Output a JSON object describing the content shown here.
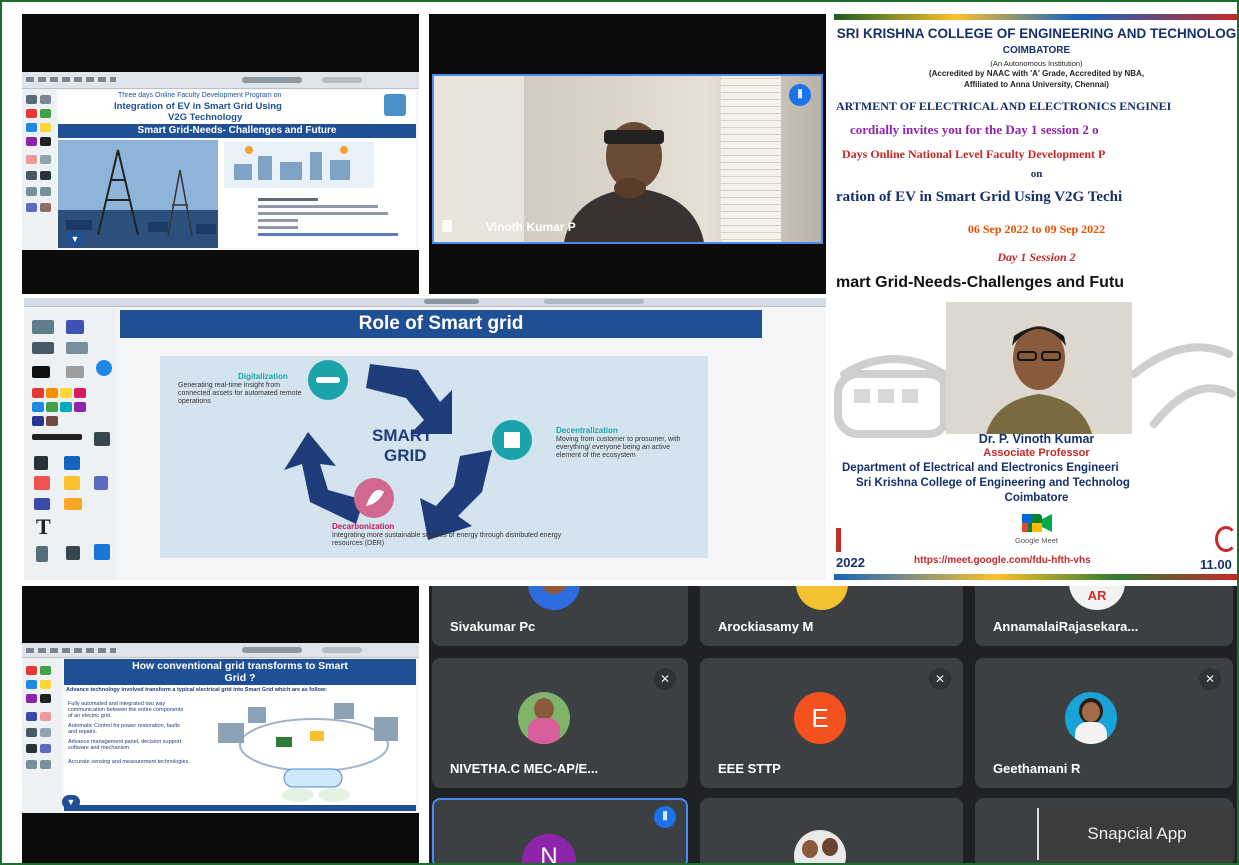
{
  "slide1": {
    "header": "Three days Online Faculty Development Program on",
    "title_line1": "Integration of EV in Smart Grid Using",
    "title_line2": "V2G Technology",
    "subtitle": "Smart Grid-Needs- Challenges and Future"
  },
  "speaker_tile": {
    "name": "Vinoth Kumar P"
  },
  "slide2": {
    "title": "Role of Smart grid",
    "center_line1": "SMART",
    "center_line2": "GRID",
    "digitalization_title": "Digitalization",
    "digitalization_text": "Generating real-time insight from connected assets for automated remote operations",
    "decentralization_title": "Decentralization",
    "decentralization_text": "Moving from customer to prosumer, with everything/ everyone being an active element of the ecosystem",
    "decarbonization_title": "Decarbonization",
    "decarbonization_text": "Integrating more sustainable sources of energy through distributed energy resources (DER)"
  },
  "slide3": {
    "title_line1": "How conventional grid transforms to Smart",
    "title_line2": "Grid ?",
    "lead": "Advance technology involved transform a typical electrical grid into Smart Grid which are as follow:",
    "bullet1": "Fully automated and integrated two way communication between the entire components of an electric grid.",
    "bullet2": "Automatic Control for power restoration, faults and repairs.",
    "bullet3": "Advance management panel, decision support software and mechanism.",
    "bullet4": "Accurate sensing and measurement technologies."
  },
  "invitation": {
    "college": "SRI KRISHNA COLLEGE OF ENGINEERING AND TECHNOLOG",
    "city": "COIMBATORE",
    "autonomous": "(An Autonomous Institution)",
    "accreditation1": "(Accredited by NAAC with 'A' Grade, Accredited by NBA,",
    "accreditation2": "Affiliated to Anna University, Chennai)",
    "department": "ARTMENT OF ELECTRICAL  AND ELECTRONICS ENGINEI",
    "invites": "cordially invites you for the Day 1 session 2 o",
    "program": "Days Online National Level  Faculty Development P",
    "on": "on",
    "topic": "ration of EV in Smart Grid Using V2G Techi",
    "dates": "06 Sep 2022  to 09 Sep 2022",
    "session": "Day 1 Session 2",
    "session_title": "mart Grid-Needs-Challenges and Futu",
    "speaker_name": "Dr. P. Vinoth Kumar",
    "speaker_role": "Associate Professor",
    "speaker_dept": "Department of  Electrical and Electronics Engineeri",
    "speaker_college": "Sri Krishna College of Engineering and Technolog",
    "speaker_city": "Coimbatore",
    "meet_label": "Google Meet",
    "date_fragment": "2022",
    "link": "https://meet.google.com/fdu-hfth-vhs",
    "time_fragment": "11.00"
  },
  "participants": {
    "p1": "Sivakumar Pc",
    "p2": "Arockiasamy M",
    "p3": "AnnamalaiRajasekara...",
    "p4": "NIVETHA.C MEC-AP/E...",
    "p5": "EEE STTP",
    "p5_initial": "E",
    "p6": "Geethamani R",
    "p7_initial": "N",
    "p3_initial": "AR"
  },
  "watermark": "Snapcial App",
  "colors": {
    "border": "#1f6d2c",
    "slide_blue": "#1f4f95",
    "meet_tile": "#3c4043",
    "invite_red": "#c62828",
    "invite_orange": "#e65100",
    "invite_navy": "#16306b"
  }
}
